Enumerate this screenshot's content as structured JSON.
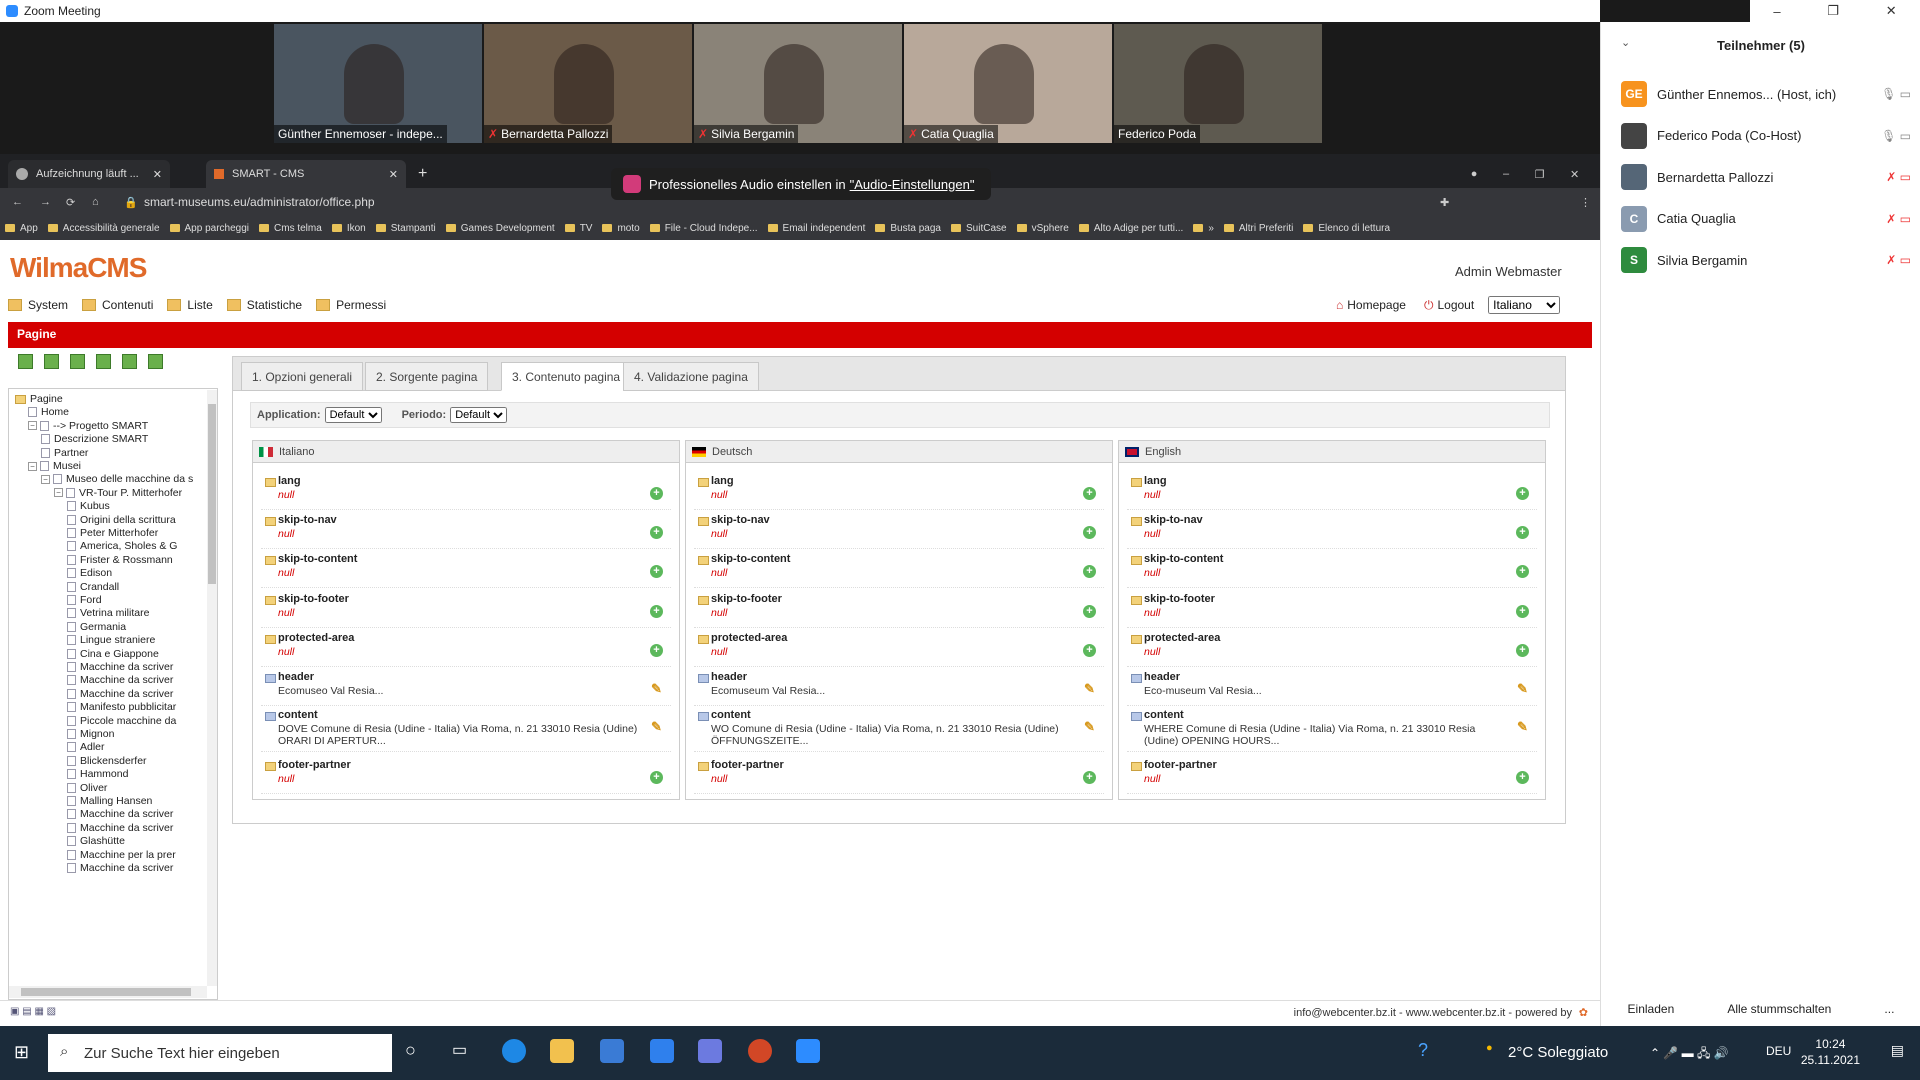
{
  "window": {
    "title": "Zoom Meeting"
  },
  "video_tiles": [
    {
      "name": "Günther Ennemoser - indepe...",
      "muted": false
    },
    {
      "name": "Bernardetta Pallozzi",
      "muted": true
    },
    {
      "name": "Silvia Bergamin",
      "muted": true
    },
    {
      "name": "Catia Quaglia",
      "muted": true
    },
    {
      "name": "Federico Poda",
      "muted": false
    }
  ],
  "browser": {
    "tabs": [
      {
        "title": "Aufzeichnung läuft ..."
      },
      {
        "title": "SMART - CMS"
      }
    ],
    "new_tab": "+",
    "url": "smart-museums.eu/administrator/office.php",
    "bookmarks": [
      "App",
      "Accessibilità generale",
      "App parcheggi",
      "Cms telma",
      "Ikon",
      "Stampanti",
      "Games Development",
      "TV",
      "moto",
      "File - Cloud Indepe...",
      "Email independent",
      "Busta paga",
      "SuitCase",
      "vSphere",
      "Alto Adige per tutti...",
      "»",
      "Altri Preferiti",
      "Elenco di lettura"
    ]
  },
  "toast": {
    "text": "Professionelles Audio einstellen in",
    "link": "\"Audio-Einstellungen\""
  },
  "cms": {
    "logo": "WilmaCMS",
    "user": "Admin Webmaster",
    "menu": [
      "System",
      "Contenuti",
      "Liste",
      "Statistiche",
      "Permessi"
    ],
    "homepage": "Homepage",
    "logout": "Logout",
    "language": "Italiano",
    "section_title": "Pagine",
    "tabs": [
      "1. Opzioni generali",
      "2. Sorgente pagina",
      "3. Contenuto pagina",
      "4. Validazione pagina"
    ],
    "filters": {
      "application_label": "Application:",
      "application_value": "Default",
      "period_label": "Periodo:",
      "period_value": "Default"
    },
    "tree": [
      {
        "label": "Pagine",
        "level": 0,
        "type": "folder"
      },
      {
        "label": "Home",
        "level": 1,
        "type": "page"
      },
      {
        "label": "--> Progetto SMART",
        "level": 1,
        "type": "page",
        "exp": "−"
      },
      {
        "label": "Descrizione SMART",
        "level": 2,
        "type": "page"
      },
      {
        "label": "Partner",
        "level": 2,
        "type": "page"
      },
      {
        "label": "Musei",
        "level": 1,
        "type": "page",
        "exp": "−"
      },
      {
        "label": "Museo delle macchine da s",
        "level": 2,
        "type": "page",
        "exp": "−"
      },
      {
        "label": "VR-Tour P. Mitterhofer",
        "level": 3,
        "type": "page",
        "exp": "−"
      },
      {
        "label": "Kubus",
        "level": 4,
        "type": "page"
      },
      {
        "label": "Origini della scrittura",
        "level": 4,
        "type": "page"
      },
      {
        "label": "Peter Mitterhofer",
        "level": 4,
        "type": "page"
      },
      {
        "label": "America, Sholes & G",
        "level": 4,
        "type": "page"
      },
      {
        "label": "Frister & Rossmann",
        "level": 4,
        "type": "page"
      },
      {
        "label": "Edison",
        "level": 4,
        "type": "page"
      },
      {
        "label": "Crandall",
        "level": 4,
        "type": "page"
      },
      {
        "label": "Ford",
        "level": 4,
        "type": "page"
      },
      {
        "label": "Vetrina militare",
        "level": 4,
        "type": "page"
      },
      {
        "label": "Germania",
        "level": 4,
        "type": "page"
      },
      {
        "label": "Lingue straniere",
        "level": 4,
        "type": "page"
      },
      {
        "label": "Cina e Giappone",
        "level": 4,
        "type": "page"
      },
      {
        "label": "Macchine da scriver",
        "level": 4,
        "type": "page"
      },
      {
        "label": "Macchine da scriver",
        "level": 4,
        "type": "page"
      },
      {
        "label": "Macchine da scriver",
        "level": 4,
        "type": "page"
      },
      {
        "label": "Manifesto pubblicitar",
        "level": 4,
        "type": "page"
      },
      {
        "label": "Piccole macchine da",
        "level": 4,
        "type": "page"
      },
      {
        "label": "Mignon",
        "level": 4,
        "type": "page"
      },
      {
        "label": "Adler",
        "level": 4,
        "type": "page"
      },
      {
        "label": "Blickensderfer",
        "level": 4,
        "type": "page"
      },
      {
        "label": "Hammond",
        "level": 4,
        "type": "page"
      },
      {
        "label": "Oliver",
        "level": 4,
        "type": "page"
      },
      {
        "label": "Malling Hansen",
        "level": 4,
        "type": "page"
      },
      {
        "label": "Macchine da scriver",
        "level": 4,
        "type": "page"
      },
      {
        "label": "Macchine da scriver",
        "level": 4,
        "type": "page"
      },
      {
        "label": "Glashütte",
        "level": 4,
        "type": "page"
      },
      {
        "label": "Macchine per la prer",
        "level": 4,
        "type": "page"
      },
      {
        "label": "Macchine da scriver",
        "level": 4,
        "type": "page"
      }
    ],
    "columns": [
      {
        "lang": "Italiano",
        "flag": "it",
        "rows": [
          {
            "key": "lang",
            "value": "null",
            "null": true,
            "kind": "add"
          },
          {
            "key": "skip-to-nav",
            "value": "null",
            "null": true,
            "kind": "add"
          },
          {
            "key": "skip-to-content",
            "value": "null",
            "null": true,
            "kind": "add"
          },
          {
            "key": "skip-to-footer",
            "value": "null",
            "null": true,
            "kind": "add"
          },
          {
            "key": "protected-area",
            "value": "null",
            "null": true,
            "kind": "add"
          },
          {
            "key": "header",
            "value": "Ecomuseo Val Resia...",
            "null": false,
            "kind": "edit"
          },
          {
            "key": "content",
            "value": "DOVE Comune di Resia (Udine - Italia) Via Roma, n. 21 33010 Resia (Udine) ORARI DI APERTUR...",
            "null": false,
            "kind": "edit"
          },
          {
            "key": "footer-partner",
            "value": "null",
            "null": true,
            "kind": "add"
          }
        ]
      },
      {
        "lang": "Deutsch",
        "flag": "de",
        "rows": [
          {
            "key": "lang",
            "value": "null",
            "null": true,
            "kind": "add"
          },
          {
            "key": "skip-to-nav",
            "value": "null",
            "null": true,
            "kind": "add"
          },
          {
            "key": "skip-to-content",
            "value": "null",
            "null": true,
            "kind": "add"
          },
          {
            "key": "skip-to-footer",
            "value": "null",
            "null": true,
            "kind": "add"
          },
          {
            "key": "protected-area",
            "value": "null",
            "null": true,
            "kind": "add"
          },
          {
            "key": "header",
            "value": "Ecomuseum Val Resia...",
            "null": false,
            "kind": "edit"
          },
          {
            "key": "content",
            "value": "WO Comune di Resia (Udine - Italia) Via Roma, n. 21 33010 Resia (Udine) ÖFFNUNGSZEITE...",
            "null": false,
            "kind": "edit"
          },
          {
            "key": "footer-partner",
            "value": "null",
            "null": true,
            "kind": "add"
          }
        ]
      },
      {
        "lang": "English",
        "flag": "en",
        "rows": [
          {
            "key": "lang",
            "value": "null",
            "null": true,
            "kind": "add"
          },
          {
            "key": "skip-to-nav",
            "value": "null",
            "null": true,
            "kind": "add"
          },
          {
            "key": "skip-to-content",
            "value": "null",
            "null": true,
            "kind": "add"
          },
          {
            "key": "skip-to-footer",
            "value": "null",
            "null": true,
            "kind": "add"
          },
          {
            "key": "protected-area",
            "value": "null",
            "null": true,
            "kind": "add"
          },
          {
            "key": "header",
            "value": "Eco-museum Val Resia...",
            "null": false,
            "kind": "edit"
          },
          {
            "key": "content",
            "value": "WHERE Comune di Resia (Udine - Italia) Via Roma, n. 21 33010 Resia (Udine) OPENING HOURS...",
            "null": false,
            "kind": "edit"
          },
          {
            "key": "footer-partner",
            "value": "null",
            "null": true,
            "kind": "add"
          }
        ]
      }
    ],
    "footer": "info@webcenter.bz.it - www.webcenter.bz.it - powered by"
  },
  "participants": {
    "title": "Teilnehmer (5)",
    "list": [
      {
        "initials": "GE",
        "name": "Günther Ennemos... (Host, ich)",
        "color": "#f7931e"
      },
      {
        "initials": "",
        "name": "Federico Poda (Co-Host)",
        "color": "#444"
      },
      {
        "initials": "",
        "name": "Bernardetta Pallozzi",
        "color": "#556677"
      },
      {
        "initials": "C",
        "name": "Catia Quaglia",
        "color": "#8a9bb0"
      },
      {
        "initials": "S",
        "name": "Silvia Bergamin",
        "color": "#2e8b3e"
      }
    ],
    "buttons": [
      "Einladen",
      "Alle stummschalten",
      "..."
    ]
  },
  "taskbar": {
    "search_placeholder": "Zur Suche Text hier eingeben",
    "weather": "2°C Soleggiato",
    "lang": "DEU",
    "time": "10:24",
    "date": "25.11.2021"
  }
}
